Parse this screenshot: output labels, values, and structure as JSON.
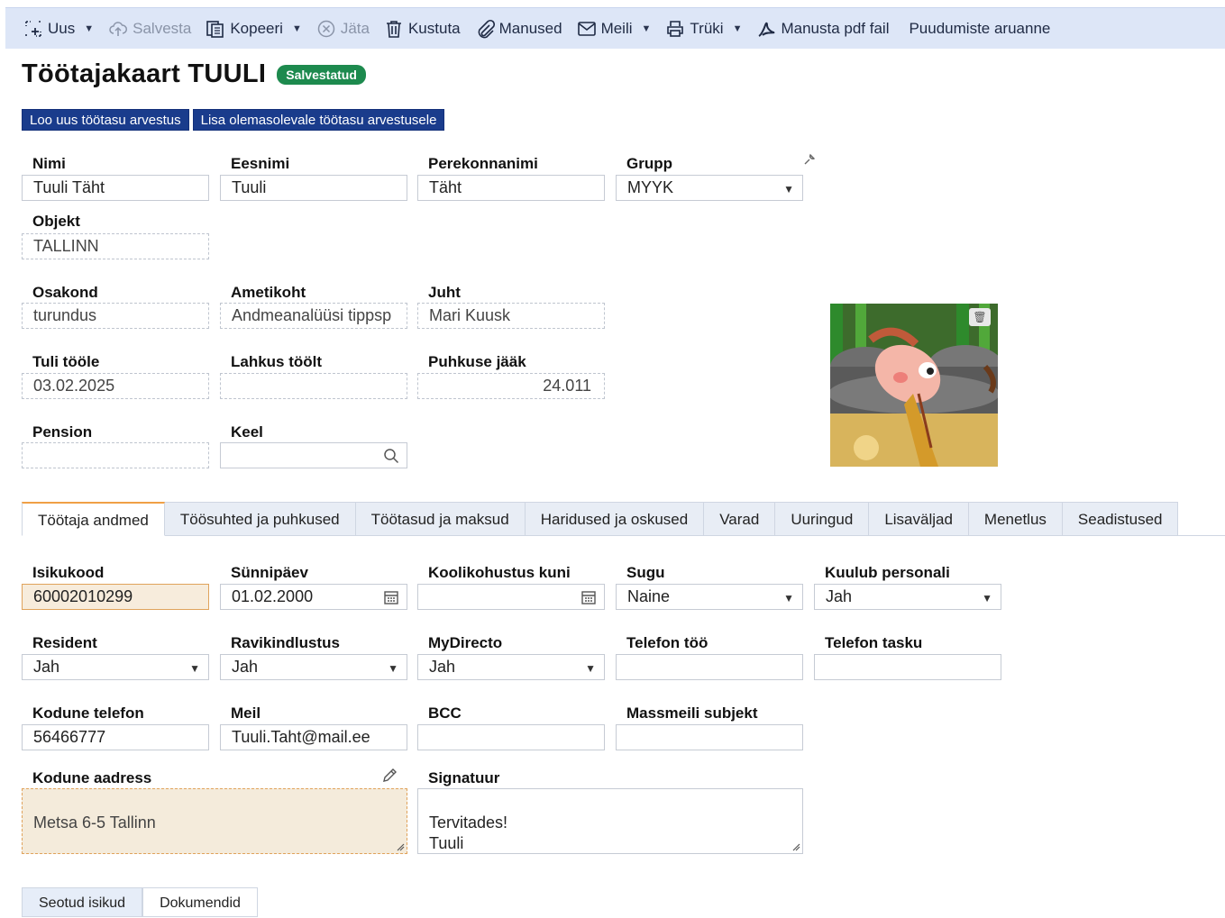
{
  "toolbar": {
    "new": "Uus",
    "save": "Salvesta",
    "copy": "Kopeeri",
    "cancel": "Jäta",
    "delete": "Kustuta",
    "attachments": "Manused",
    "mail": "Meili",
    "print": "Trüki",
    "attach_pdf": "Manusta pdf fail",
    "absence_report": "Puudumiste aruanne"
  },
  "header": {
    "title": "Töötajakaart TUULI",
    "status": "Salvestatud",
    "btn_new_payroll": "Loo uus töötasu arvestus",
    "btn_add_payroll": "Lisa olemasolevale töötasu arvestusele"
  },
  "fields": {
    "nimi": {
      "label": "Nimi",
      "value": "Tuuli Täht"
    },
    "eesnimi": {
      "label": "Eesnimi",
      "value": "Tuuli"
    },
    "perekonnanimi": {
      "label": "Perekonnanimi",
      "value": "Täht"
    },
    "grupp": {
      "label": "Grupp",
      "value": "MYYK"
    },
    "objekt": {
      "label": "Objekt",
      "value": "TALLINN"
    },
    "osakond": {
      "label": "Osakond",
      "value": "turundus"
    },
    "ametikoht": {
      "label": "Ametikoht",
      "value": "Andmeanalüüsi tippsp"
    },
    "juht": {
      "label": "Juht",
      "value": "Mari Kuusk"
    },
    "tuli_toole": {
      "label": "Tuli tööle",
      "value": "03.02.2025"
    },
    "lahkus_toolt": {
      "label": "Lahkus töölt",
      "value": ""
    },
    "puhkuse_jaak": {
      "label": "Puhkuse jääk",
      "value": "24.011"
    },
    "pension": {
      "label": "Pension",
      "value": ""
    },
    "keel": {
      "label": "Keel",
      "value": ""
    }
  },
  "tabs": [
    "Töötaja andmed",
    "Töösuhted ja puhkused",
    "Töötasud ja maksud",
    "Haridused ja oskused",
    "Varad",
    "Uuringud",
    "Lisaväljad",
    "Menetlus",
    "Seadistused"
  ],
  "details": {
    "isikukood": {
      "label": "Isikukood",
      "value": "60002010299"
    },
    "sunnipaev": {
      "label": "Sünnipäev",
      "value": "01.02.2000"
    },
    "koolikohustus": {
      "label": "Koolikohustus kuni",
      "value": ""
    },
    "sugu": {
      "label": "Sugu",
      "value": "Naine"
    },
    "kuulub_personali": {
      "label": "Kuulub personali",
      "value": "Jah"
    },
    "resident": {
      "label": "Resident",
      "value": "Jah"
    },
    "ravikindlustus": {
      "label": "Ravikindlustus",
      "value": "Jah"
    },
    "mydirecto": {
      "label": "MyDirecto",
      "value": "Jah"
    },
    "telefon_too": {
      "label": "Telefon töö",
      "value": ""
    },
    "telefon_tasku": {
      "label": "Telefon tasku",
      "value": ""
    },
    "kodune_telefon": {
      "label": "Kodune telefon",
      "value": "56466777"
    },
    "meil": {
      "label": "Meil",
      "value": "Tuuli.Taht@mail.ee"
    },
    "bcc": {
      "label": "BCC",
      "value": ""
    },
    "massmeili_subjekt": {
      "label": "Massmeili subjekt",
      "value": ""
    },
    "kodune_aadress": {
      "label": "Kodune aadress",
      "value": "Metsa 6-5  Tallinn"
    },
    "signatuur": {
      "label": "Signatuur",
      "value": "Tervitades!\nTuuli"
    }
  },
  "bottom_tabs": [
    "Seotud isikud",
    "Dokumendid"
  ],
  "colors": {
    "accent": "#1a3c8c",
    "saved_badge": "#1d8a4e",
    "active_tab_border": "#f0a046",
    "toolbar_bg": "#dde6f7"
  }
}
